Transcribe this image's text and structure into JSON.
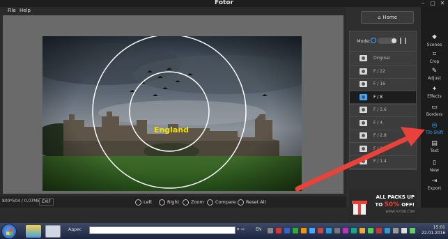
{
  "window": {
    "title": "Fotor"
  },
  "menu": {
    "file": "File",
    "help": "Help"
  },
  "photo": {
    "label": "England"
  },
  "infobar": {
    "info": "800*504 / 0.07MB",
    "exif": "EXIF",
    "tools": {
      "left": "Left",
      "right": "Right",
      "zoom": "Zoom",
      "compare": "Compare",
      "reset": "Reset All"
    }
  },
  "rightpanel": {
    "home": "Home",
    "mode_label": "Mode:",
    "options": [
      "Original",
      "F / 22",
      "F / 16",
      "F / 8",
      "F / 5.6",
      "F / 4",
      "F / 2.8",
      "F / 2",
      "F / 1.4"
    ],
    "selected_index": 3,
    "ad": {
      "line1": "ALL PACKS UP",
      "line2_prefix": "TO ",
      "percent": "50% ",
      "line2_suffix": "OFF!",
      "site": "WWW.FOTOR.COM"
    }
  },
  "sidetools": [
    "Scenes",
    "Crop",
    "Adjust",
    "Effects",
    "Borders",
    "Tilt-Shift",
    "Text",
    "New",
    "Export"
  ],
  "sidetools_active": "Tilt-Shift",
  "taskbar": {
    "address_label": "Адрес",
    "lang": "EN",
    "time": "15:01",
    "date": "22.01.2016"
  },
  "colors": {
    "accent": "#3fa8ff",
    "label": "#f4e000",
    "arrow": "#e8423a",
    "ad_red": "#e8433a"
  }
}
